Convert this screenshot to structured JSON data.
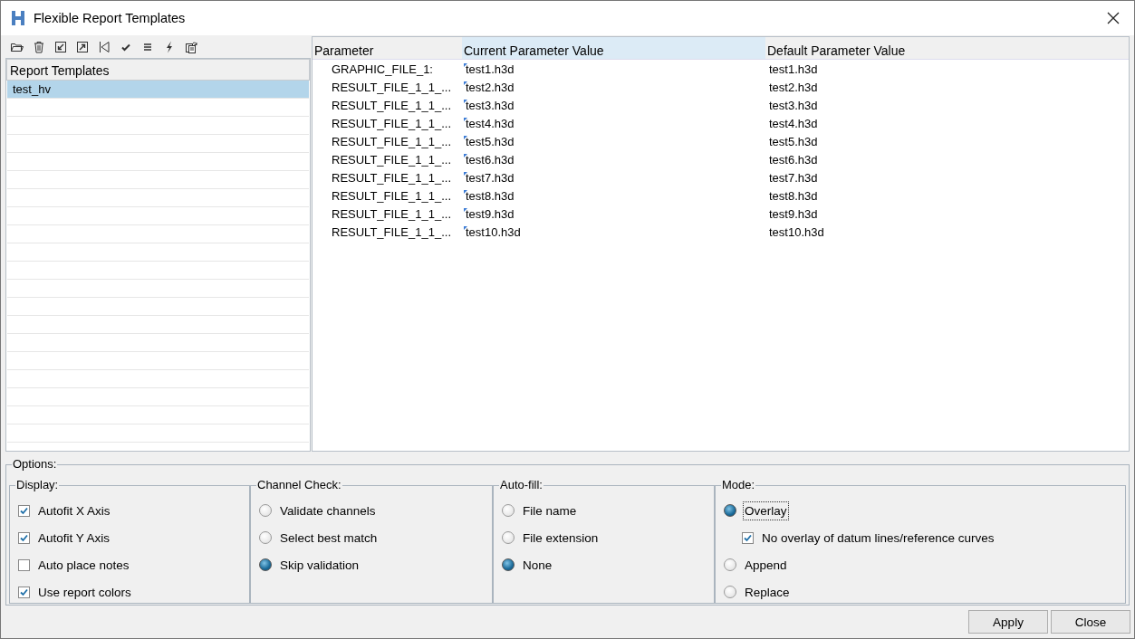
{
  "window": {
    "title": "Flexible Report Templates"
  },
  "templates": {
    "heading": "Report Templates",
    "items": [
      {
        "label": "test_hv",
        "selected": true
      }
    ]
  },
  "table": {
    "columns": [
      {
        "label": "Parameter",
        "selected": false
      },
      {
        "label": "Current Parameter Value",
        "selected": true
      },
      {
        "label": "Default Parameter Value",
        "selected": false
      }
    ],
    "rows": [
      {
        "parameter": "GRAPHIC_FILE_1:",
        "current": "test1.h3d",
        "default": "test1.h3d"
      },
      {
        "parameter": "RESULT_FILE_1_1_...",
        "current": "test2.h3d",
        "default": "test2.h3d"
      },
      {
        "parameter": "RESULT_FILE_1_1_...",
        "current": "test3.h3d",
        "default": "test3.h3d"
      },
      {
        "parameter": "RESULT_FILE_1_1_...",
        "current": "test4.h3d",
        "default": "test4.h3d"
      },
      {
        "parameter": "RESULT_FILE_1_1_...",
        "current": "test5.h3d",
        "default": "test5.h3d"
      },
      {
        "parameter": "RESULT_FILE_1_1_...",
        "current": "test6.h3d",
        "default": "test6.h3d"
      },
      {
        "parameter": "RESULT_FILE_1_1_...",
        "current": "test7.h3d",
        "default": "test7.h3d"
      },
      {
        "parameter": "RESULT_FILE_1_1_...",
        "current": "test8.h3d",
        "default": "test8.h3d"
      },
      {
        "parameter": "RESULT_FILE_1_1_...",
        "current": "test9.h3d",
        "default": "test9.h3d"
      },
      {
        "parameter": "RESULT_FILE_1_1_...",
        "current": "test10.h3d",
        "default": "test10.h3d"
      }
    ]
  },
  "options": {
    "title": "Options:",
    "groups": [
      {
        "title": "Display:",
        "items": [
          {
            "kind": "checkbox",
            "label": "Autofit X Axis",
            "checked": true
          },
          {
            "kind": "checkbox",
            "label": "Autofit Y Axis",
            "checked": true
          },
          {
            "kind": "checkbox",
            "label": "Auto place notes",
            "checked": false
          },
          {
            "kind": "checkbox",
            "label": "Use report colors",
            "checked": true
          }
        ]
      },
      {
        "title": "Channel Check:",
        "items": [
          {
            "kind": "radio",
            "label": "Validate channels",
            "selected": false
          },
          {
            "kind": "radio",
            "label": "Select best match",
            "selected": false
          },
          {
            "kind": "radio",
            "label": "Skip validation",
            "selected": true
          }
        ]
      },
      {
        "title": "Auto-fill:",
        "items": [
          {
            "kind": "radio",
            "label": "File name",
            "selected": false
          },
          {
            "kind": "radio",
            "label": "File extension",
            "selected": false
          },
          {
            "kind": "radio",
            "label": "None",
            "selected": true
          }
        ]
      },
      {
        "title": "Mode:",
        "items": [
          {
            "kind": "radio",
            "label": "Overlay",
            "selected": true,
            "focused": true,
            "children": [
              {
                "kind": "checkbox",
                "label": "No overlay of datum lines/reference curves",
                "checked": true
              }
            ]
          },
          {
            "kind": "radio",
            "label": "Append",
            "selected": false
          },
          {
            "kind": "radio",
            "label": "Replace",
            "selected": false
          }
        ]
      }
    ]
  },
  "buttons": [
    "Apply",
    "Close"
  ]
}
